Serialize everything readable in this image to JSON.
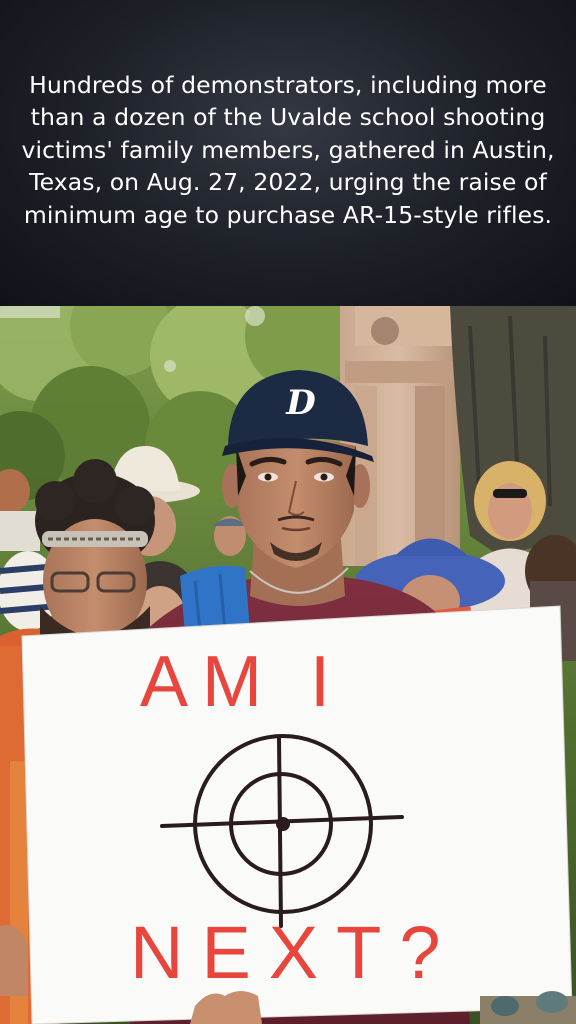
{
  "caption": "Hundreds of demonstrators, including more than a dozen of the Uvalde school shooting victims' family members, gathered in Austin, Texas, on Aug. 27, 2022, urging the raise of minimum age to purchase AR-15-style rifles.",
  "photo": {
    "cap_logo": "D",
    "sign_line1": "AM I",
    "sign_line2": "NEXT?"
  },
  "colors": {
    "caption_bg": "#1c1f26",
    "caption_text": "#ffffff",
    "sign_ink_red": "#e8453c",
    "sign_ink_dark": "#2a1c1c",
    "cap_navy": "#1d2a44",
    "shirt_maroon": "#7a2b3a"
  }
}
